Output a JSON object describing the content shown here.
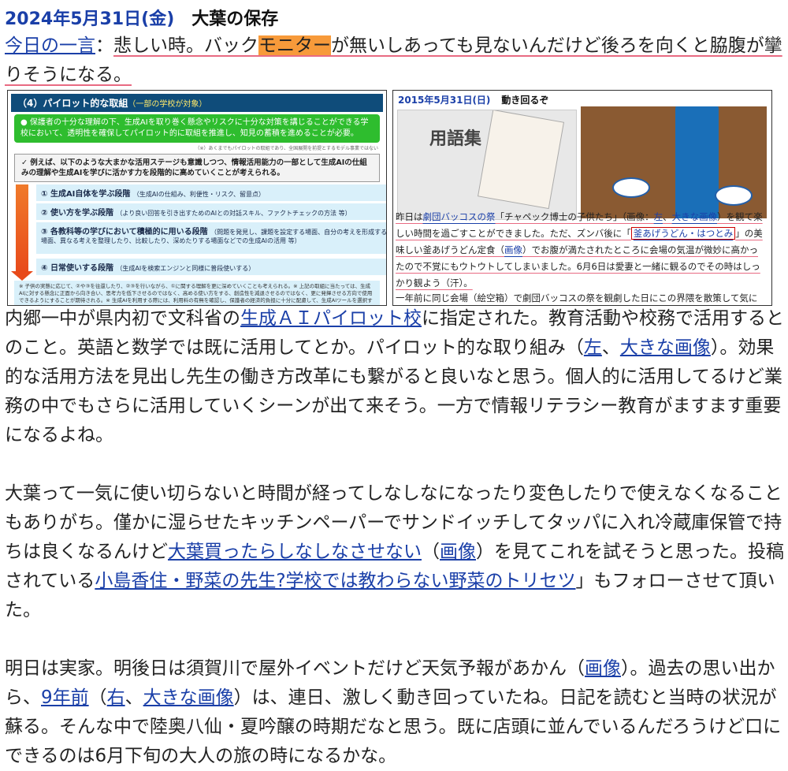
{
  "header": {
    "date": "2024年5月31日(金)",
    "title": "大葉の保存"
  },
  "lead": {
    "link": "今日の一言",
    "colon": "：",
    "t1": "悲しい時。バック",
    "highlight": "モニター",
    "t2": "が無いしあっても見ないんだけど後ろを向くと脇腹が攣りそうになる。"
  },
  "left_image": {
    "heading": "（4）パイロット的な取組",
    "heading_sub": "（一部の学校が対象）",
    "green_text": "● 保護者の十分な理解の下、生成AIを取り巻く懸念やリスクに十分な対策を講じることができる学校において、透明性を確保してパイロット的に取組を推進し、知見の蓄積を進めることが必要。",
    "note1": "（※）あくまでもパイロットの取組であり、全国展開を前提とするモデル事業ではない",
    "box_text": "✓ 例えば、以下のような大まかな活用ステージも意識しつつ、情報活用能力の一部として生成AIの仕組みの理解や生成AIを学びに活かす力を段階的に高めていくことが考えられる。",
    "stages": [
      {
        "label": "① 生成AI自体を学ぶ段階",
        "sub": "（生成AIの仕組み、利便性・リスク、留意点）"
      },
      {
        "label": "② 使い方を学ぶ段階",
        "sub": "（より良い回答を引き出すためのAIとの対話スキル、ファクトチェックの方法 等）"
      },
      {
        "label": "③ 各教科等の学びにおいて積極的に用いる段階",
        "sub": "（問題を発見し、課題を設定する場面、自分の考えを形成する場面、異なる考えを整理したり、比較したり、深めたりする場面などでの生成AIの活用 等）"
      },
      {
        "label": "④ 日常使いする段階",
        "sub": "（生成AIを検索エンジンと同様に普段使いする）"
      }
    ],
    "footnotes": "※ 子供の実態に応じて、②や③を往還したり、②③を行いながら、①に関する理解を更に深めていくことも考えられる。※ 上記の取組に当たっては、生成AIに対する懸念に正面から向き合い、思考力を低下させるのではなく、高める使い方をする、創造性を減退させるのではなく、更に発揮させる方向で使用できるようにすることが期待される。※ 生成AIを利用する際には、利用料の有無を確認し、保護者の経済的負担に十分に配慮して、生成AIツールを選択することが必要。"
  },
  "right_image": {
    "date": "2015年5月31日(日)",
    "title": "動き回るぞ",
    "photo_label": "用語集",
    "text_pre": "昨日は",
    "link1": "劇団バッコスの祭",
    "text_a": "「チャペック博士の子供たち」（画像：",
    "link2": "左",
    "text_b": "、",
    "link3": "大きな画像",
    "text_c": "）を観て楽しい時間を過ごすことができました。ただ、ズンバ後に「",
    "boxed": "釜あげうどん・はつとみ",
    "text_d": "」の美味しい釜あげうどん定食（",
    "link4": "画像",
    "text_e": "）でお腹が満たされたところに会場の気温が微妙に高かったので不覚にもウトウトしてしまいました。6月6日は愛妻と一緒に観るのでその時はしっかり観よう（汗）。",
    "bottom": "一年前に同じ会場（絵空箱）で劇団バッコスの祭を観劇した日にこの界隈を散策して気に"
  },
  "body": {
    "p1_a": "内郷一中が県内初で文科省の",
    "p1_link1": "生成ＡＩパイロット校",
    "p1_b": "に指定された。教育活動や校務で活用するとのこと。英語と数学では既に活用してとか。パイロット的な取り組み（",
    "p1_link2": "左",
    "p1_c": "、",
    "p1_link3": "大きな画像",
    "p1_d": "）。効果的な活用方法を見出し先生の働き方改革にも繋がると良いなと思う。個人的に活用してるけど業務の中でもさらに活用していくシーンが出て来そう。一方で情報リテラシー教育がますます重要になるよね。",
    "p2_a": "大葉って一気に使い切らないと時間が経ってしなしなになったり変色したりで使えなくなることもありがち。僅かに湿らせたキッチンペーパーでサンドイッチしてタッパに入れ冷蔵庫保管で持ちは良くなるんけど",
    "p2_link1": "大葉買ったらしなしなさせない",
    "p2_b": "（",
    "p2_link2": "画像",
    "p2_c": "）を見てこれを試そうと思った。投稿されている",
    "p2_link3": "小島香住・野菜の先生?学校では教わらない野菜のトリセツ",
    "p2_d": "」もフォローさせて頂いた。",
    "p3_a": "明日は実家。明後日は須賀川で屋外イベントだけど天気予報があかん（",
    "p3_link1": "画像",
    "p3_b": "）。過去の思い出から、",
    "p3_link2": "9年前",
    "p3_c": "（",
    "p3_link3": "右",
    "p3_d": "、",
    "p3_link4": "大きな画像",
    "p3_e": "）は、連日、激しく動き回っていたね。日記を読むと当時の状況が蘇る。そんな中で陸奥八仙・夏吟醸の時期だなと思う。既に店頭に並んでいるんだろうけど口にできるのは6月下旬の大人の旅の時になるかな。"
  },
  "colors": {
    "link": "#1a3fa8",
    "highlight": "#f79a3a",
    "underline": "#e86a82"
  }
}
